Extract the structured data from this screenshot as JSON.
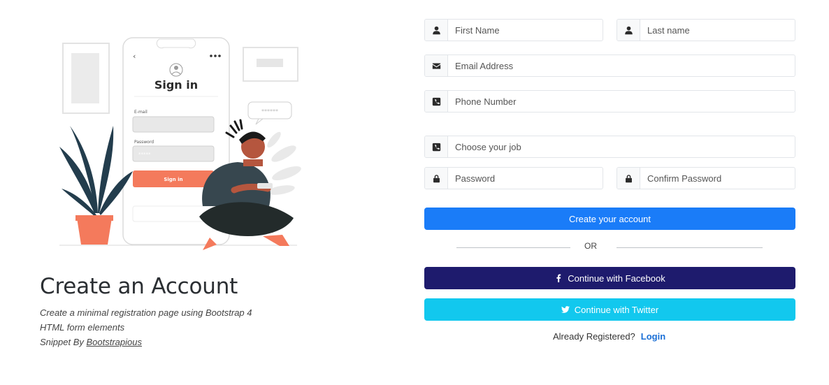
{
  "illustration": {
    "phone_title": "Sign in",
    "email_label": "E-mail",
    "password_label": "Password",
    "password_mask": "*****",
    "signin_button": "Sign in",
    "speech_mask": "******"
  },
  "intro": {
    "title": "Create an Account",
    "description_line1": "Create a minimal registration page using Bootstrap 4",
    "description_line2": "HTML form elements",
    "credit_prefix": "Snippet By ",
    "credit_link": "Bootstrapious"
  },
  "form": {
    "first_name": {
      "placeholder": "First Name",
      "icon": "user-icon"
    },
    "last_name": {
      "placeholder": "Last name",
      "icon": "user-icon"
    },
    "email": {
      "placeholder": "Email Address",
      "icon": "envelope-icon"
    },
    "phone": {
      "placeholder": "Phone Number",
      "icon": "phone-square-icon"
    },
    "job": {
      "placeholder": "Choose your job",
      "icon": "phone-square-icon"
    },
    "password": {
      "placeholder": "Password",
      "icon": "lock-icon"
    },
    "confirm_password": {
      "placeholder": "Confirm Password",
      "icon": "lock-icon"
    },
    "create_button": "Create your account",
    "or_text": "OR",
    "facebook_button": "Continue with Facebook",
    "twitter_button": "Continue with Twitter",
    "already_registered": "Already Registered?",
    "login_link": "Login"
  },
  "colors": {
    "primary": "#1a7cf8",
    "facebook": "#1e1b6d",
    "twitter": "#12c8ee",
    "accent": "#f47a5c"
  }
}
